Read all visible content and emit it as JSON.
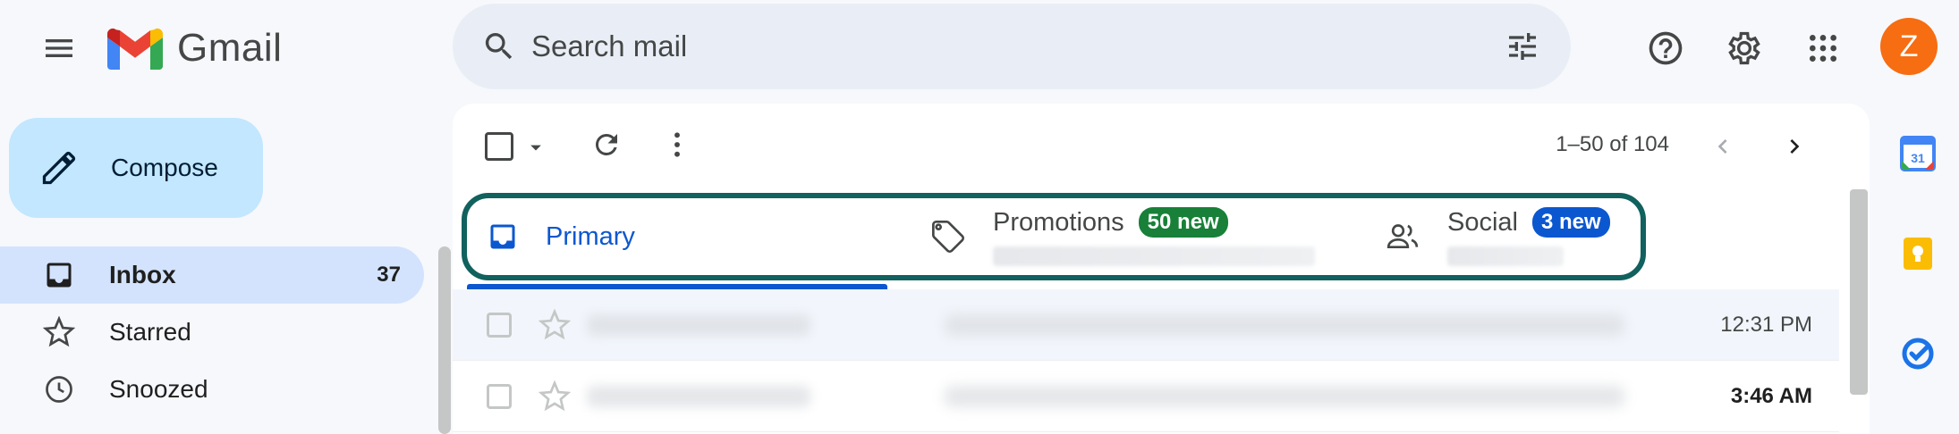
{
  "app": {
    "logo_text": "Gmail"
  },
  "search": {
    "placeholder": "Search mail"
  },
  "account": {
    "avatar_letter": "Z",
    "avatar_color": "#f66d12"
  },
  "sidebar": {
    "compose_label": "Compose",
    "items": [
      {
        "label": "Inbox",
        "count": "37",
        "icon": "inbox-icon"
      },
      {
        "label": "Starred",
        "count": "",
        "icon": "star-icon"
      },
      {
        "label": "Snoozed",
        "count": "",
        "icon": "clock-icon"
      }
    ]
  },
  "toolbar": {
    "pager": "1–50 of 104"
  },
  "tabs": [
    {
      "label": "Primary",
      "badge": "",
      "icon": "inbox-icon",
      "active": true
    },
    {
      "label": "Promotions",
      "badge": "50 new",
      "icon": "tag-icon",
      "badge_color": "#188038"
    },
    {
      "label": "Social",
      "badge": "3 new",
      "icon": "people-icon",
      "badge_color": "#0b57d0"
    }
  ],
  "emails": [
    {
      "time": "12:31 PM",
      "unread": false
    },
    {
      "time": "3:46 AM",
      "unread": true
    }
  ],
  "colors": {
    "accent": "#0b57d0",
    "highlight_border": "#11615e",
    "selected_nav": "#d3e3fd",
    "compose_bg": "#c2e7ff"
  },
  "rail": [
    "calendar-icon",
    "keep-icon",
    "tasks-icon"
  ]
}
